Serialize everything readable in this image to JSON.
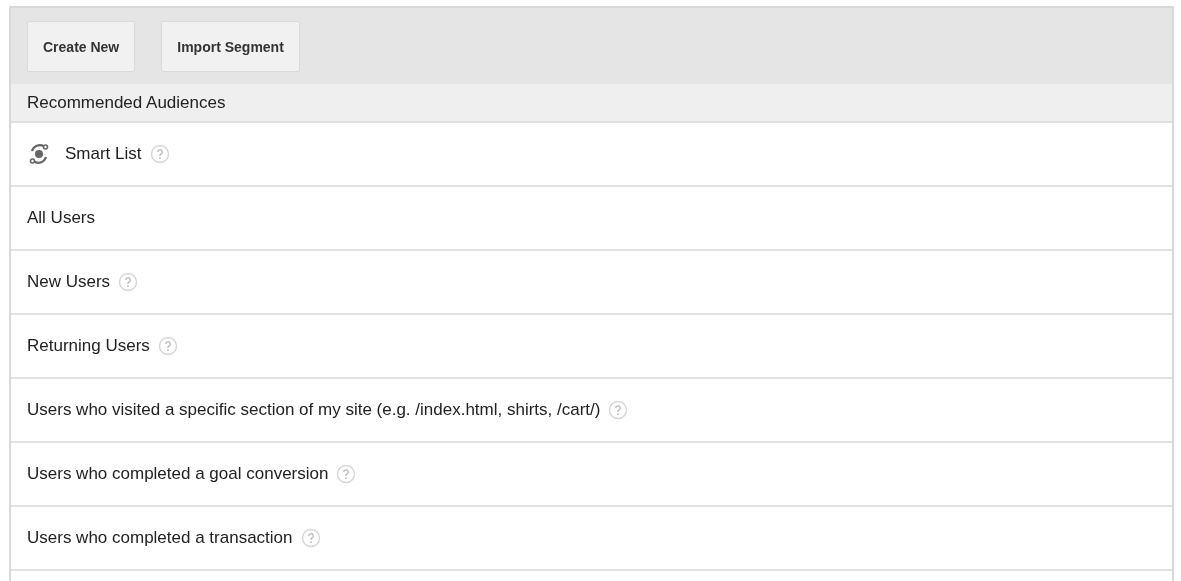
{
  "toolbar": {
    "buttons": [
      "Create New",
      "Import Segment"
    ]
  },
  "section": {
    "title": "Recommended Audiences"
  },
  "rows": [
    {
      "label": "Smart List",
      "kind": "smart",
      "help": true
    },
    {
      "label": "All Users",
      "kind": "plain",
      "help": false
    },
    {
      "label": "New Users",
      "kind": "plain",
      "help": true
    },
    {
      "label": "Returning Users",
      "kind": "plain",
      "help": true
    },
    {
      "label": "Users who visited a specific section of my site (e.g. /index.html, shirts, /cart/)",
      "kind": "plain",
      "help": true
    },
    {
      "label": "Users who completed a goal conversion",
      "kind": "plain",
      "help": true
    },
    {
      "label": "Users who completed a transaction",
      "kind": "plain",
      "help": true
    }
  ]
}
